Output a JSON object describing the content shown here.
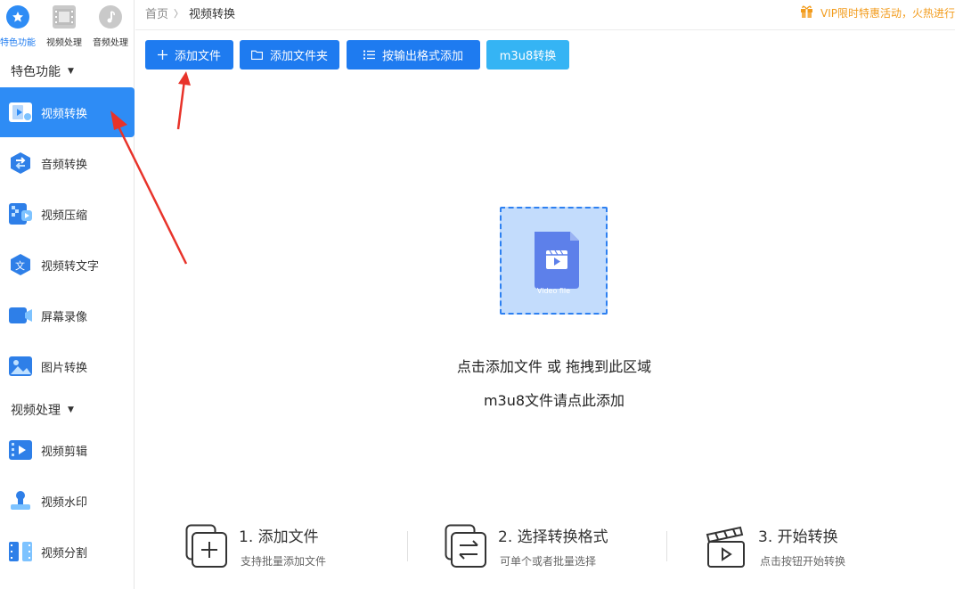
{
  "sidebar": {
    "top_tabs": [
      {
        "label": "特色功能",
        "icon": "star-icon"
      },
      {
        "label": "视频处理",
        "icon": "film-icon"
      },
      {
        "label": "音频处理",
        "icon": "music-icon"
      }
    ],
    "sections": [
      {
        "title": "特色功能"
      },
      {
        "title": "视频处理"
      }
    ],
    "items": [
      {
        "label": "视频转换",
        "icon": "video-convert-icon"
      },
      {
        "label": "音频转换",
        "icon": "audio-convert-icon"
      },
      {
        "label": "视频压缩",
        "icon": "video-compress-icon"
      },
      {
        "label": "视频转文字",
        "icon": "video-to-text-icon"
      },
      {
        "label": "屏幕录像",
        "icon": "screen-record-icon"
      },
      {
        "label": "图片转换",
        "icon": "image-convert-icon"
      },
      {
        "label": "视频剪辑",
        "icon": "video-edit-icon"
      },
      {
        "label": "视频水印",
        "icon": "watermark-icon"
      },
      {
        "label": "视频分割",
        "icon": "video-split-icon"
      }
    ]
  },
  "header": {
    "breadcrumb": [
      "首页",
      "视频转换"
    ],
    "promo": "VIP限时特惠活动，火热进行"
  },
  "toolbar": {
    "add_file": "添加文件",
    "add_folder": "添加文件夹",
    "add_by_format": "按输出格式添加",
    "m3u8": "m3u8转换"
  },
  "dropzone": {
    "file_caption": "Video file",
    "line1": "点击添加文件 或 拖拽到此区域",
    "line2": "m3u8文件请点此添加"
  },
  "steps": [
    {
      "title": "1. 添加文件",
      "subtitle": "支持批量添加文件"
    },
    {
      "title": "2. 选择转换格式",
      "subtitle": "可单个或者批量选择"
    },
    {
      "title": "3. 开始转换",
      "subtitle": "点击按钮开始转换"
    }
  ],
  "colors": {
    "primary": "#1e7bf0",
    "active_nav": "#2e8cf5",
    "m3u8_button": "#35b4f4",
    "promo": "#f29b1b",
    "annotation_arrow": "#e8332a"
  }
}
